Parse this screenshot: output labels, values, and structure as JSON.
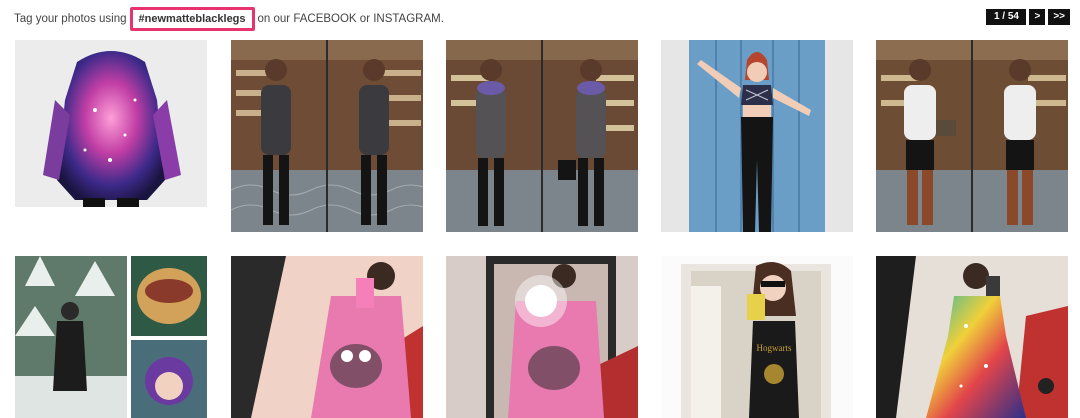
{
  "header": {
    "prefix": "Tag your photos using",
    "hashtag": "#newmatteblacklegs",
    "suffix": "on our FACEBOOK or INSTAGRAM."
  },
  "pagination": {
    "page": "1 / 54",
    "next": ">",
    "last": ">>"
  },
  "gallery": {
    "rows": 2,
    "columns": 5,
    "items": [
      {
        "name": "photo-galaxy-hoodie",
        "scene": "studio",
        "outfit": "galaxy hoodie dress",
        "accent": "#d94a9c"
      },
      {
        "name": "photo-mirror-selfie-grey-dress-duo",
        "scene": "shoe closet",
        "outfit": "grey dress, knee boots",
        "accent": "#4a4a4d"
      },
      {
        "name": "photo-mirror-selfie-scarf-duo",
        "scene": "shoe closet",
        "outfit": "grey dress, purple scarf",
        "accent": "#6b5aa8"
      },
      {
        "name": "photo-blue-door-crop-top",
        "scene": "blue door",
        "outfit": "geometric crop top, black leggings",
        "accent": "#2b2f4a"
      },
      {
        "name": "photo-mirror-selfie-white-top-duo",
        "scene": "shoe closet",
        "outfit": "white top, brown boots",
        "accent": "#eeeeee"
      },
      {
        "name": "photo-snow-collage",
        "scene": "snowy forest collage",
        "outfit": "black coat",
        "accent": "#2a2a2a"
      },
      {
        "name": "photo-pink-sweater-selfie",
        "scene": "mirror",
        "outfit": "pink cookie monster sweater",
        "accent": "#e87ab0"
      },
      {
        "name": "photo-pink-sweater-flash",
        "scene": "mirror flash",
        "outfit": "pink cookie monster sweater",
        "accent": "#e87ab0"
      },
      {
        "name": "photo-hogwarts-polaroid",
        "scene": "polaroid",
        "outfit": "hogwarts tank",
        "accent": "#c9a234"
      },
      {
        "name": "photo-galaxy-skater-dress",
        "scene": "mirror",
        "outfit": "rainbow galaxy skater dress",
        "accent": "#2cb5a8"
      }
    ]
  }
}
